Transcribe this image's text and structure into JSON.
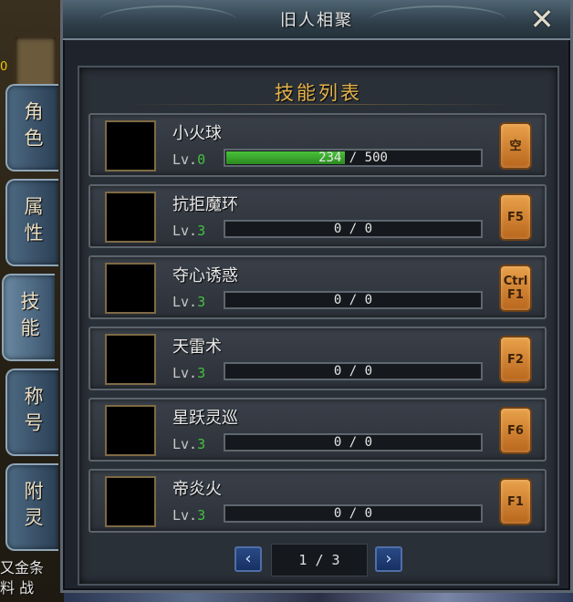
{
  "left_bg": {
    "zero": "0",
    "bottom_lines": [
      "又金条",
      "料 战"
    ]
  },
  "side_tabs": [
    {
      "label": "角色",
      "active": false
    },
    {
      "label": "属性",
      "active": false
    },
    {
      "label": "技能",
      "active": true
    },
    {
      "label": "称号",
      "active": false
    },
    {
      "label": "附灵",
      "active": false
    }
  ],
  "window": {
    "title": "旧人相聚",
    "close_glyph": "✕"
  },
  "section_title": "技能列表",
  "level_prefix": "Lv.",
  "skills": [
    {
      "name": "小火球",
      "level": "0",
      "progress": "234 / 500",
      "progress_fraction": 0.468,
      "key": "空",
      "icon": "fireball-icon"
    },
    {
      "name": "抗拒魔环",
      "level": "3",
      "progress": "0 / 0",
      "progress_fraction": 0,
      "key": "F5",
      "icon": "repel-ring-icon"
    },
    {
      "name": "夺心诱惑",
      "level": "3",
      "progress": "0 / 0",
      "progress_fraction": 0,
      "key": "Ctrl F1",
      "icon": "charm-icon"
    },
    {
      "name": "天雷术",
      "level": "3",
      "progress": "0 / 0",
      "progress_fraction": 0,
      "key": "F2",
      "icon": "thunder-icon"
    },
    {
      "name": "星跃灵巡",
      "level": "3",
      "progress": "0 / 0",
      "progress_fraction": 0,
      "key": "F6",
      "icon": "star-leap-icon"
    },
    {
      "name": "帝炎火",
      "level": "3",
      "progress": "0 / 0",
      "progress_fraction": 0,
      "key": "F1",
      "icon": "imperial-flame-icon"
    }
  ],
  "pager": {
    "page": "1 / 3",
    "prev_glyph": "‹",
    "next_glyph": "›"
  }
}
